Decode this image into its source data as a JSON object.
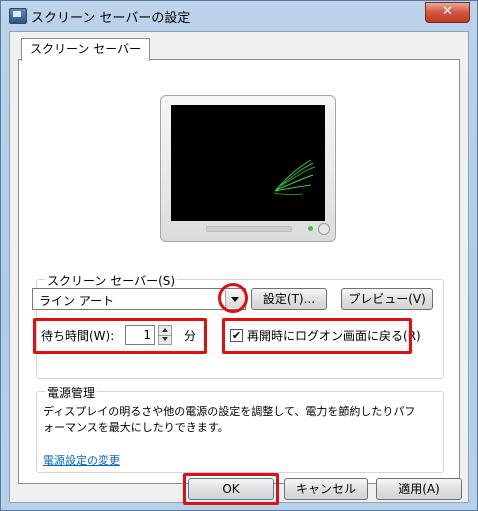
{
  "window": {
    "title": "スクリーン セーバーの設定",
    "close_label": "✕"
  },
  "tab": {
    "label": "スクリーン セーバー"
  },
  "screensaver_group": {
    "label": "スクリーン セーバー(S)",
    "selected": "ライン アート",
    "settings_button": "設定(T)...",
    "preview_button": "プレビュー(V)",
    "wait_label": "待ち時間(W):",
    "wait_value": "1",
    "wait_unit": "分",
    "resume_checked": true,
    "resume_label": "再開時にログオン画面に戻る(R)"
  },
  "power_group": {
    "label": "電源管理",
    "description_line1": "ディスプレイの明るさや他の電源の設定を調整して、電力を節約したりパフ",
    "description_line2": "ォーマンスを最大にしたりできます。",
    "link": "電源設定の変更"
  },
  "footer": {
    "ok": "OK",
    "cancel": "キャンセル",
    "apply": "適用(A)"
  },
  "colors": {
    "highlight": "#e01010",
    "link": "#0066cc",
    "screen_line": "#2ecc40"
  }
}
